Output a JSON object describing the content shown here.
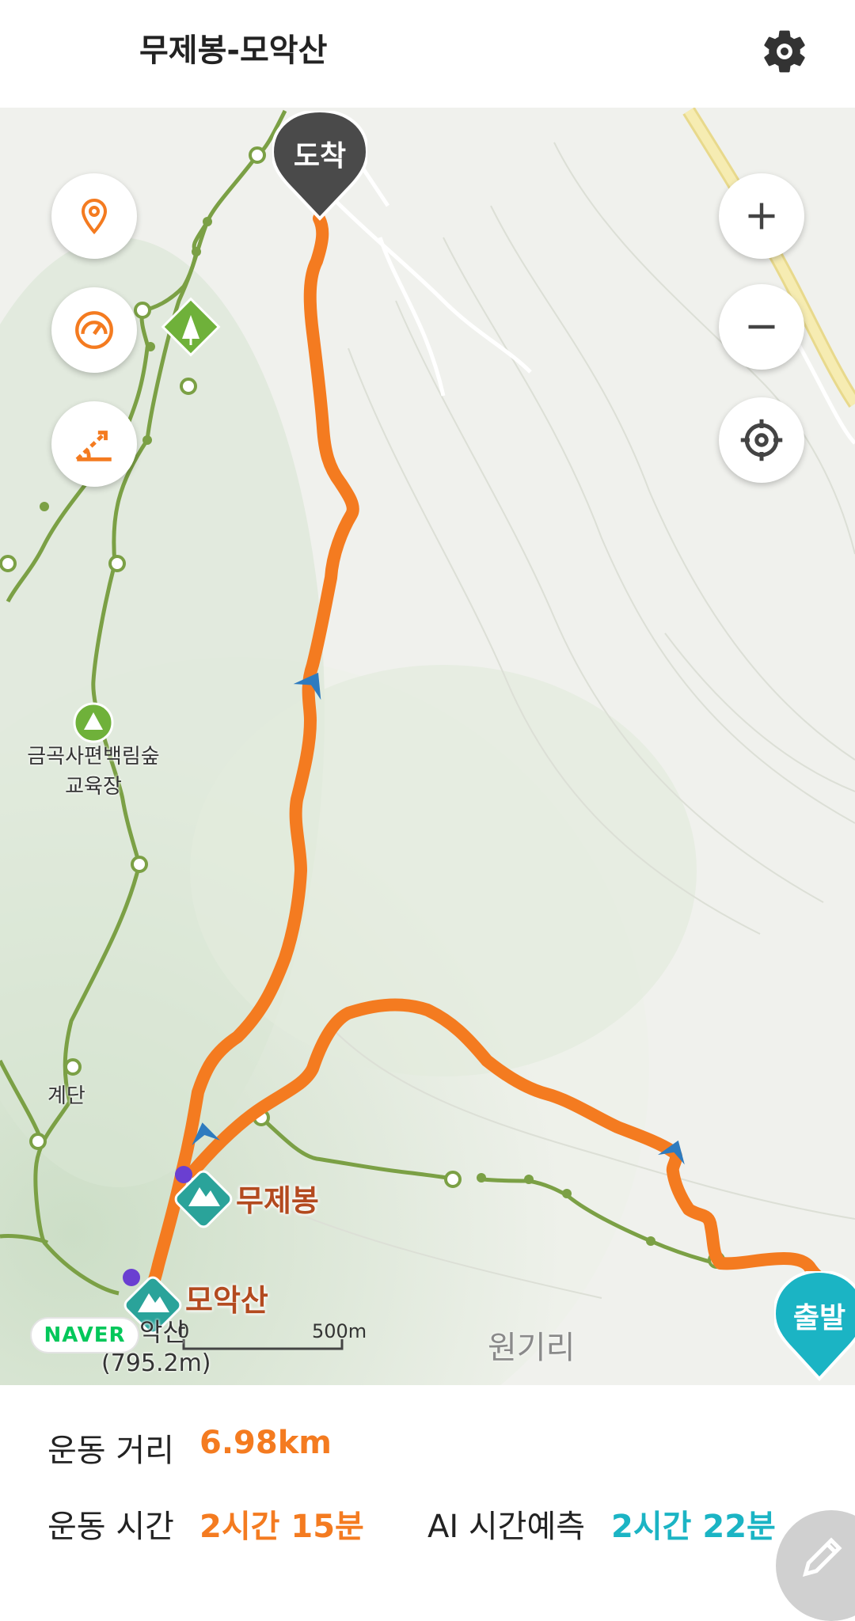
{
  "header": {
    "title": "무제봉-모악산",
    "back_icon": "back-arrow-icon",
    "settings_icon": "gear-icon"
  },
  "map": {
    "markers": {
      "arrive": "도착",
      "start": "출발"
    },
    "peaks": [
      {
        "name": "무제봉"
      },
      {
        "name": "모악산"
      }
    ],
    "places": {
      "campsite": "금곡사편백림숲\n교육장",
      "stairs": "계단",
      "village": "원기리",
      "summit_partial": "악산",
      "summit_elevation": "(795.2m)"
    },
    "attribution": "NAVER",
    "scale": {
      "zero": "0",
      "distance": "500m"
    },
    "controls": [
      "location-pin-icon",
      "speedometer-icon",
      "slope-icon",
      "zoom-in-icon",
      "zoom-out-icon",
      "current-location-icon"
    ],
    "colors": {
      "route": "#f47b20",
      "trail": "#7ba045",
      "road": "#f2e6a6",
      "marker_arrive": "#4a4a4a",
      "marker_start": "#1bb4c4"
    }
  },
  "stats": {
    "distance_label": "운동 거리",
    "distance_value": "6.98km",
    "time_label": "운동 시간",
    "time_value": "2시간 15분",
    "ai_label": "AI 시간예측",
    "ai_value": "2시간 22분"
  },
  "fab": {
    "icon": "pencil-icon"
  }
}
